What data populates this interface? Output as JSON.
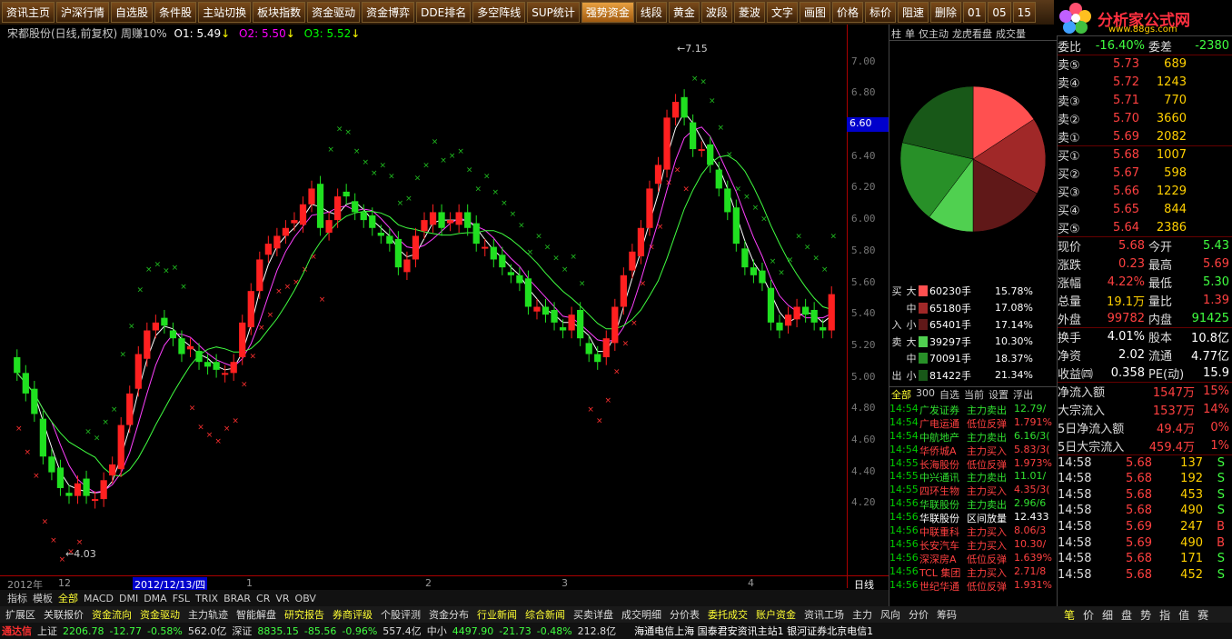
{
  "topbar": [
    "资讯主页",
    "沪深行情",
    "自选股",
    "条件股",
    "主站切换",
    "板块指数",
    "资金驱动",
    "资金博弈",
    "DDE排名",
    "多空阵线",
    "SUP统计",
    "强势资金",
    "线段",
    "黄金",
    "波段",
    "菱波",
    "文字",
    "画图",
    "价格",
    "标价",
    "阻速",
    "删除",
    "01",
    "05",
    "15"
  ],
  "topbar_active": 11,
  "logo": {
    "brand": "分析家公式网",
    "url": "www.88gs.com"
  },
  "chart": {
    "title": "宋都股份(日线,前复权) 周赚10%",
    "o1": "O1: 5.49",
    "o2": "O2: 5.50",
    "o3": "O3: 5.52",
    "high_label": "7.15",
    "low_label": "4.03",
    "price_tag": "6.60",
    "x_date_label": "2012/12/13/四",
    "period_label": "日线"
  },
  "yticks": [
    "7.00",
    "6.80",
    "6.60",
    "6.40",
    "6.20",
    "6.00",
    "5.80",
    "5.60",
    "5.40",
    "5.20",
    "5.00",
    "4.80",
    "4.60",
    "4.40",
    "4.20"
  ],
  "xticks": [
    "2012年",
    "12",
    "1",
    "2",
    "3",
    "4"
  ],
  "indicator_tabs": [
    "指标",
    "模板",
    "全部",
    "MACD",
    "DMI",
    "DMA",
    "FSL",
    "TRIX",
    "BRAR",
    "CR",
    "VR",
    "OBV"
  ],
  "bottom_tabs": [
    "扩展区",
    "关联报价",
    "资金流向",
    "资金驱动",
    "主力轨迹",
    "智能解盘",
    "研究报告",
    "券商评级",
    "个股评测",
    "资金分布",
    "行业新闻",
    "综合新闻",
    "买卖详盘",
    "成交明细",
    "分价表",
    "委托成交",
    "账户资金",
    "资讯工场",
    "主力",
    "风向",
    "分价",
    "筹码"
  ],
  "status": {
    "app": "通达信",
    "sh_label": "上证",
    "sh": "2206.78",
    "sh_chg": "-12.77",
    "sh_pct": "-0.58%",
    "sh_amt": "562.0亿",
    "sz_label": "深证",
    "sz": "8835.15",
    "sz_chg": "-85.56",
    "sz_pct": "-0.96%",
    "sz_amt": "557.4亿",
    "zx_label": "中小",
    "zx": "4497.90",
    "zx_chg": "-21.73",
    "zx_pct": "-0.48%",
    "zx_amt": "212.8亿",
    "servers": "海通电信上海  国泰君安资讯主站1  银河证券北京电信1"
  },
  "right_tabs": [
    "柱",
    "单",
    "仅主动",
    "龙虎看盘",
    "成交量"
  ],
  "pie": [
    {
      "label": "大买",
      "pct": 15.78,
      "color": "#ff5050"
    },
    {
      "label": "中买",
      "pct": 17.08,
      "color": "#a02828"
    },
    {
      "label": "小买",
      "pct": 17.14,
      "color": "#601818"
    },
    {
      "label": "大卖",
      "pct": 10.3,
      "color": "#50d050"
    },
    {
      "label": "中卖",
      "pct": 18.37,
      "color": "#289028"
    },
    {
      "label": "小卖",
      "pct": 21.34,
      "color": "#185818"
    }
  ],
  "flow": [
    {
      "g": "买",
      "s": "大",
      "val": "60230手",
      "pct": "15.78%",
      "color": "#ff5050"
    },
    {
      "g": "",
      "s": "中",
      "val": "65180手",
      "pct": "17.08%",
      "color": "#a02828"
    },
    {
      "g": "入",
      "s": "小",
      "val": "65401手",
      "pct": "17.14%",
      "color": "#601818"
    },
    {
      "g": "卖",
      "s": "大",
      "val": "39297手",
      "pct": "10.30%",
      "color": "#50d050"
    },
    {
      "g": "",
      "s": "中",
      "val": "70091手",
      "pct": "18.37%",
      "color": "#289028"
    },
    {
      "g": "出",
      "s": "小",
      "val": "81422手",
      "pct": "21.34%",
      "color": "#185818"
    }
  ],
  "news_tabs": [
    "全部",
    "300",
    "自选",
    "当前",
    "设置",
    "浮出"
  ],
  "news": [
    {
      "t": "14:54",
      "s": "广发证券",
      "a": "主力卖出",
      "v": "12.79/",
      "c": "g"
    },
    {
      "t": "14:54",
      "s": "广电运通",
      "a": "低位反弹",
      "v": "1.791%",
      "c": "r"
    },
    {
      "t": "14:54",
      "s": "中航地产",
      "a": "主力卖出",
      "v": "6.16/3(",
      "c": "g"
    },
    {
      "t": "14:54",
      "s": "华侨城A",
      "a": "主力买入",
      "v": "5.83/3(",
      "c": "r"
    },
    {
      "t": "14:55",
      "s": "长海股份",
      "a": "低位反弹",
      "v": "1.973%",
      "c": "r"
    },
    {
      "t": "14:55",
      "s": "中兴通讯",
      "a": "主力卖出",
      "v": "11.01/",
      "c": "g"
    },
    {
      "t": "14:55",
      "s": "四环生物",
      "a": "主力买入",
      "v": "4.35/3(",
      "c": "r"
    },
    {
      "t": "14:56",
      "s": "华联股份",
      "a": "主力卖出",
      "v": "2.96/6",
      "c": "g"
    },
    {
      "t": "14:56",
      "s": "华联股份",
      "a": "区间放量",
      "v": "12.433",
      "c": "w"
    },
    {
      "t": "14:56",
      "s": "中联重科",
      "a": "主力买入",
      "v": "8.06/3",
      "c": "r"
    },
    {
      "t": "14:56",
      "s": "长安汽车",
      "a": "主力买入",
      "v": "10.30/",
      "c": "r"
    },
    {
      "t": "14:56",
      "s": "深深房A",
      "a": "低位反弹",
      "v": "1.639%",
      "c": "r"
    },
    {
      "t": "14:56",
      "s": "TCL 集团",
      "a": "主力买入",
      "v": "2.71/8",
      "c": "r"
    },
    {
      "t": "14:56",
      "s": "世纪华通",
      "a": "低位反弹",
      "v": "1.931%",
      "c": "r"
    }
  ],
  "quote": {
    "weibi_label": "委比",
    "weibi": "-16.40%",
    "weicha_label": "委差",
    "weicha": "-2380",
    "sells": [
      {
        "l": "卖⑤",
        "p": "5.73",
        "v": "689"
      },
      {
        "l": "卖④",
        "p": "5.72",
        "v": "1243"
      },
      {
        "l": "卖③",
        "p": "5.71",
        "v": "770"
      },
      {
        "l": "卖②",
        "p": "5.70",
        "v": "3660"
      },
      {
        "l": "卖①",
        "p": "5.69",
        "v": "2082"
      }
    ],
    "buys": [
      {
        "l": "买①",
        "p": "5.68",
        "v": "1007"
      },
      {
        "l": "买②",
        "p": "5.67",
        "v": "598"
      },
      {
        "l": "买③",
        "p": "5.66",
        "v": "1229"
      },
      {
        "l": "买④",
        "p": "5.65",
        "v": "844"
      },
      {
        "l": "买⑤",
        "p": "5.64",
        "v": "2386"
      }
    ],
    "kv1": [
      {
        "k1": "现价",
        "v1": "5.68",
        "c1": "#ff4040",
        "k2": "今开",
        "v2": "5.43",
        "c2": "#40ff40"
      },
      {
        "k1": "涨跌",
        "v1": "0.23",
        "c1": "#ff4040",
        "k2": "最高",
        "v2": "5.69",
        "c2": "#ff4040"
      },
      {
        "k1": "涨幅",
        "v1": "4.22%",
        "c1": "#ff4040",
        "k2": "最低",
        "v2": "5.30",
        "c2": "#40ff40"
      },
      {
        "k1": "总量",
        "v1": "19.1万",
        "c1": "#ffd000",
        "k2": "量比",
        "v2": "1.39",
        "c2": "#ff4040"
      },
      {
        "k1": "外盘",
        "v1": "99782",
        "c1": "#ff4040",
        "k2": "内盘",
        "v2": "91425",
        "c2": "#40ff40"
      }
    ],
    "kv2": [
      {
        "k1": "换手",
        "v1": "4.01%",
        "c1": "#ffffff",
        "k2": "股本",
        "v2": "10.8亿",
        "c2": "#ffffff"
      },
      {
        "k1": "净资",
        "v1": "2.02",
        "c1": "#ffffff",
        "k2": "流通",
        "v2": "4.77亿",
        "c2": "#ffffff"
      },
      {
        "k1": "收益㈣",
        "v1": "0.358",
        "c1": "#ffffff",
        "k2": "PE(动)",
        "v2": "15.9",
        "c2": "#ffffff"
      }
    ],
    "flows": [
      {
        "k": "净流入额",
        "v": "1547万",
        "p": "15%"
      },
      {
        "k": "大宗流入",
        "v": "1537万",
        "p": "14%"
      },
      {
        "k": "5日净流入额",
        "v": "49.4万",
        "p": "0%"
      },
      {
        "k": "5日大宗流入",
        "v": "459.4万",
        "p": "1%"
      }
    ],
    "ticks": [
      {
        "t": "14:58",
        "p": "5.68",
        "v": "137",
        "f": "S"
      },
      {
        "t": "14:58",
        "p": "5.68",
        "v": "192",
        "f": "S"
      },
      {
        "t": "14:58",
        "p": "5.68",
        "v": "453",
        "f": "S"
      },
      {
        "t": "14:58",
        "p": "5.68",
        "v": "490",
        "f": "S"
      },
      {
        "t": "14:58",
        "p": "5.69",
        "v": "247",
        "f": "B"
      },
      {
        "t": "14:58",
        "p": "5.69",
        "v": "490",
        "f": "B"
      },
      {
        "t": "14:58",
        "p": "5.68",
        "v": "171",
        "f": "S"
      },
      {
        "t": "14:58",
        "p": "5.68",
        "v": "452",
        "f": "S"
      }
    ]
  },
  "right_bottom": [
    "笔",
    "价",
    "细",
    "盘",
    "势",
    "指",
    "值",
    "赛"
  ],
  "chart_data": {
    "type": "candlestick",
    "ymin": 4.0,
    "ymax": 7.2,
    "closes": [
      5.18,
      5.05,
      4.92,
      4.65,
      4.55,
      4.45,
      4.4,
      4.48,
      4.4,
      4.38,
      4.5,
      4.6,
      4.85,
      5.05,
      5.3,
      5.45,
      5.5,
      5.48,
      5.4,
      5.3,
      5.35,
      5.25,
      5.22,
      5.2,
      5.18,
      5.25,
      5.5,
      5.7,
      5.9,
      6.0,
      6.05,
      6.1,
      6.15,
      6.25,
      6.35,
      6.1,
      6.15,
      6.3,
      6.3,
      6.2,
      6.15,
      6.1,
      6.05,
      6.0,
      5.85,
      5.9,
      6.05,
      6.15,
      6.2,
      6.1,
      6.15,
      6.2,
      6.1,
      6.0,
      5.98,
      5.9,
      5.85,
      5.8,
      5.75,
      5.6,
      5.6,
      5.55,
      5.5,
      5.45,
      5.55,
      5.4,
      5.3,
      5.25,
      5.4,
      5.6,
      5.8,
      5.95,
      6.1,
      6.35,
      6.5,
      6.8,
      6.9,
      6.8,
      6.6,
      6.6,
      6.5,
      6.35,
      6.2,
      6.0,
      5.85,
      5.8,
      5.75,
      5.5,
      5.45,
      5.55,
      5.6,
      5.55,
      5.5,
      5.45,
      5.68
    ]
  }
}
